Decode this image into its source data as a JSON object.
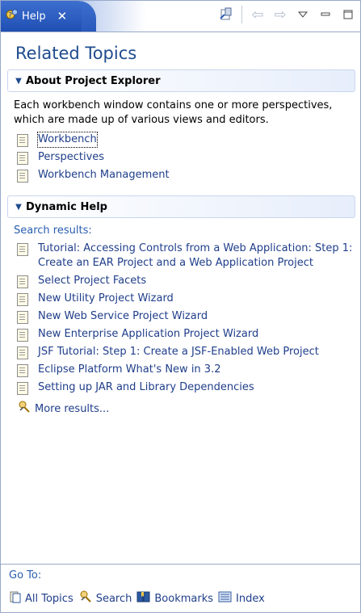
{
  "window": {
    "tab_title": "Help",
    "tab_icon": "help-icon"
  },
  "toolbar": {
    "buttons": [
      "show-in-contents-icon",
      "back-icon",
      "forward-icon",
      "view-menu-icon",
      "minimize-icon",
      "maximize-icon"
    ]
  },
  "page_title": "Related Topics",
  "about_section": {
    "heading": "About Project Explorer",
    "description": "Each workbench window contains one or more perspectives, which are made up of various views and editors.",
    "links": [
      "Workbench",
      "Perspectives",
      "Workbench Management"
    ]
  },
  "dynamic_section": {
    "heading": "Dynamic Help",
    "search_results_label": "Search results:",
    "links": [
      "Tutorial: Accessing Controls from a Web Application: Step 1: Create an EAR Project and a Web Application Project",
      "Select Project Facets",
      "New Utility Project Wizard",
      "New Web Service Project Wizard",
      "New Enterprise Application Project Wizard",
      "JSF Tutorial: Step 1: Create a JSF-Enabled Web Project",
      "Eclipse Platform What's New in 3.2",
      "Setting up JAR and Library Dependencies"
    ],
    "more_results": "More results..."
  },
  "goto": {
    "label": "Go To:",
    "links": [
      {
        "label": "All Topics",
        "icon": "all-topics-icon"
      },
      {
        "label": "Search",
        "icon": "search-icon"
      },
      {
        "label": "Bookmarks",
        "icon": "bookmarks-icon"
      },
      {
        "label": "Index",
        "icon": "index-icon"
      }
    ]
  },
  "colors": {
    "tab_blue": "#2456bd",
    "link": "#1f3e8a",
    "heading_blue": "#1f4b8f"
  }
}
